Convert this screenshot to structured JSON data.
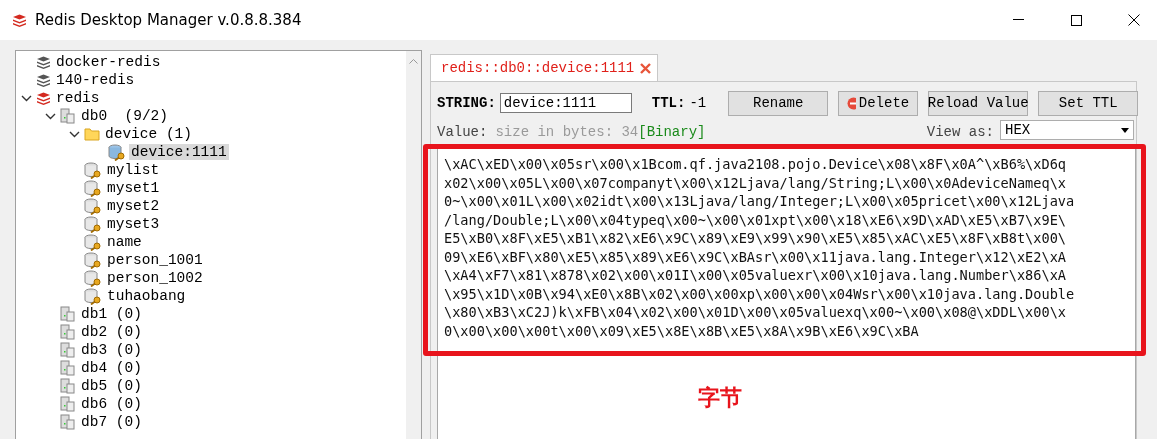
{
  "window": {
    "title": "Redis Desktop Manager v.0.8.8.384"
  },
  "tree": [
    {
      "kind": "server",
      "label": "docker-redis",
      "connected": false,
      "expanded": false,
      "selected": false
    },
    {
      "kind": "server",
      "label": "140-redis",
      "connected": false,
      "expanded": false,
      "selected": false
    },
    {
      "kind": "server",
      "label": "redis",
      "connected": true,
      "expanded": true,
      "selected": false,
      "children": [
        {
          "kind": "db",
          "label": "db0  (9/2)",
          "expanded": true,
          "selected": false,
          "children": [
            {
              "kind": "folder",
              "label": "device (1)",
              "expanded": true,
              "selected": false,
              "children": [
                {
                  "kind": "key",
                  "label": "device:1111",
                  "selected": true
                }
              ]
            },
            {
              "kind": "key",
              "label": "mylist",
              "selected": false
            },
            {
              "kind": "key",
              "label": "myset1",
              "selected": false
            },
            {
              "kind": "key",
              "label": "myset2",
              "selected": false
            },
            {
              "kind": "key",
              "label": "myset3",
              "selected": false
            },
            {
              "kind": "key",
              "label": "name",
              "selected": false
            },
            {
              "kind": "key",
              "label": "person_1001",
              "selected": false
            },
            {
              "kind": "key",
              "label": "person_1002",
              "selected": false
            },
            {
              "kind": "key",
              "label": "tuhaobang",
              "selected": false
            }
          ]
        },
        {
          "kind": "db",
          "label": "db1 (0)",
          "expanded": false,
          "selected": false
        },
        {
          "kind": "db",
          "label": "db2 (0)",
          "expanded": false,
          "selected": false
        },
        {
          "kind": "db",
          "label": "db3 (0)",
          "expanded": false,
          "selected": false
        },
        {
          "kind": "db",
          "label": "db4 (0)",
          "expanded": false,
          "selected": false
        },
        {
          "kind": "db",
          "label": "db5 (0)",
          "expanded": false,
          "selected": false
        },
        {
          "kind": "db",
          "label": "db6 (0)",
          "expanded": false,
          "selected": false
        },
        {
          "kind": "db",
          "label": "db7 (0)",
          "expanded": false,
          "selected": false
        }
      ]
    }
  ],
  "tabs": [
    {
      "label": "redis::db0::device:1111",
      "selected": true
    }
  ],
  "key_bar": {
    "type_label": "STRING:",
    "key_name": "device:1111",
    "ttl_label": "TTL:",
    "ttl": "-1",
    "buttons": [
      {
        "label": "Rename",
        "kind": "plain"
      },
      {
        "label": "Delete",
        "kind": "delete"
      },
      {
        "label": "Reload Value",
        "kind": "plain"
      },
      {
        "label": "Set TTL",
        "kind": "plain"
      }
    ]
  },
  "value_bar": {
    "label": "Value:",
    "size": "size in bytes: 34",
    "format": "[Binary]",
    "view_as_label": "View as:",
    "view_as": "HEX"
  },
  "value_lines": [
    "\\xAC\\xED\\x00\\x05sr\\x00\\x1Bcom.qf.java2108.pojo.Device\\x08\\x8F\\x0A^\\xB6%\\xD6q",
    "x02\\x00\\x05L\\x00\\x07companyt\\x00\\x12Ljava/lang/String;L\\x00\\x0AdeviceNameq\\x",
    "0~\\x00\\x01L\\x00\\x02idt\\x00\\x13Ljava/lang/Integer;L\\x00\\x05pricet\\x00\\x12Ljava",
    "/lang/Double;L\\x00\\x04typeq\\x00~\\x00\\x01xpt\\x00\\x18\\xE6\\x9D\\xAD\\xE5\\xB7\\x9E\\",
    "E5\\xB0\\x8F\\xE5\\xB1\\x82\\xE6\\x9C\\x89\\xE9\\x99\\x90\\xE5\\x85\\xAC\\xE5\\x8F\\xB8t\\x00\\",
    "09\\xE6\\xBF\\x80\\xE5\\x85\\x89\\xE6\\x9C\\xBAsr\\x00\\x11java.lang.Integer\\x12\\xE2\\xA",
    "\\xA4\\xF7\\x81\\x878\\x02\\x00\\x01I\\x00\\x05valuexr\\x00\\x10java.lang.Number\\x86\\xA",
    "\\x95\\x1D\\x0B\\x94\\xE0\\x8B\\x02\\x00\\x00xp\\x00\\x00\\x04Wsr\\x00\\x10java.lang.Double",
    "\\x80\\xB3\\xC2J)k\\xFB\\x04\\x02\\x00\\x01D\\x00\\x05valuexq\\x00~\\x00\\x08@\\xDDL\\x00\\x",
    "0\\x00\\x00\\x00t\\x00\\x09\\xE5\\x8E\\x8B\\xE5\\x8A\\x9B\\xE6\\x9C\\xBA"
  ],
  "annotation": {
    "label": "字节"
  }
}
